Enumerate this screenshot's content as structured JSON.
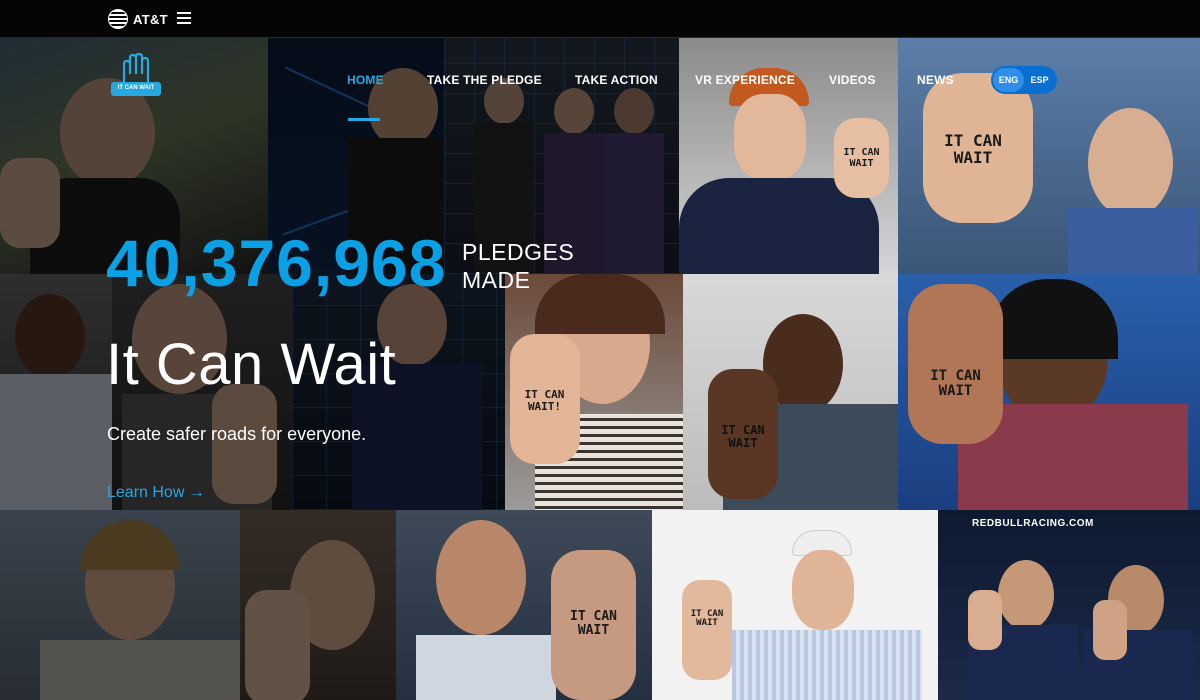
{
  "brand": {
    "name": "AT&T"
  },
  "logo": {
    "line1": "IT CAN WAIT"
  },
  "nav": {
    "items": [
      {
        "label": "HOME"
      },
      {
        "label": "TAKE THE PLEDGE"
      },
      {
        "label": "TAKE ACTION"
      },
      {
        "label": "VR EXPERIENCE"
      },
      {
        "label": "VIDEOS"
      },
      {
        "label": "NEWS"
      }
    ]
  },
  "language": {
    "eng": "ENG",
    "esp": "ESP"
  },
  "hero": {
    "count": "40,376,968",
    "count_label_1": "PLEDGES",
    "count_label_2": "MADE",
    "headline": "It Can Wait",
    "subhead": "Create safer roads for everyone.",
    "cta": "Learn How →"
  },
  "photos": {
    "hand_text": "IT CAN WAIT",
    "hand_text_excl": "IT CAN WAIT!",
    "sponsor_banner": "REDBULLRACING.COM"
  },
  "colors": {
    "accent": "#28a8e0",
    "count": "#0aa0e6",
    "lang_toggle": "#0a6fd0"
  }
}
